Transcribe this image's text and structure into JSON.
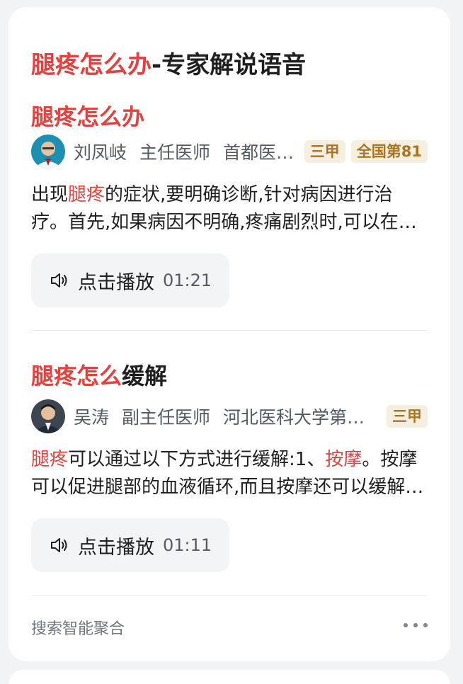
{
  "card": {
    "title_highlight": "腿疼怎么办",
    "title_rest": "-专家解说语音",
    "items": [
      {
        "title_highlight": "腿疼怎么办",
        "title_rest": "",
        "doctor_name": "刘凤岐",
        "doctor_title": "主任医师",
        "hospital": "首都医科大学附属北京友谊医院",
        "badges": [
          "三甲",
          "全国第81"
        ],
        "snippet_pre": "出现",
        "snippet_hl1": "腿疼",
        "snippet_mid": "的症状,要明确诊断,针对病因进行治疗。首先,如果病因不明确,疼痛剧烈时,可以在医生指导下使用止痛药物。",
        "snippet_hl2": "",
        "snippet_post": "",
        "play_label": "点击播放",
        "duration": "01:21"
      },
      {
        "title_highlight": "腿疼怎么",
        "title_rest": "缓解",
        "doctor_name": "吴涛",
        "doctor_title": "副主任医师",
        "hospital": "河北医科大学第三医院",
        "badges": [
          "三甲"
        ],
        "snippet_pre": "",
        "snippet_hl1": "腿疼",
        "snippet_mid": "可以通过以下方式进行缓解:1、",
        "snippet_hl2": "按摩",
        "snippet_post": "。按摩可以促进腿部的血液循环,而且按摩还可以缓解肌肉的紧张与疲劳。",
        "play_label": "点击播放",
        "duration": "01:11"
      }
    ],
    "footer": "搜索智能聚合",
    "icons": {
      "play": "speaker-icon",
      "more": "more-dots-icon"
    },
    "colors": {
      "highlight": "#e5413f",
      "badge_bg": "#f6efe0",
      "badge_text": "#a87622"
    }
  }
}
